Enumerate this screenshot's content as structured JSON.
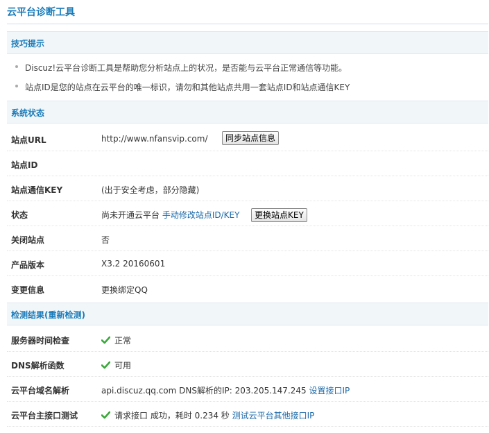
{
  "page": {
    "title": "云平台诊断工具"
  },
  "tips": {
    "header": "技巧提示",
    "items": [
      "Discuz!云平台诊断工具是帮助您分析站点上的状况，是否能与云平台正常通信等功能。",
      "站点ID是您的站点在云平台的唯一标识，请勿和其他站点共用一套站点ID和站点通信KEY"
    ]
  },
  "system": {
    "header": "系统状态",
    "site_url": {
      "label": "站点URL",
      "value": "http://www.nfansvip.com/",
      "button": "同步站点信息"
    },
    "site_id": {
      "label": "站点ID",
      "value": ""
    },
    "site_key": {
      "label": "站点通信KEY",
      "value": "(出于安全考虑，部分隐藏)"
    },
    "status": {
      "label": "状态",
      "value": "尚未开通云平台",
      "link": "手动修改站点ID/KEY",
      "button": "更换站点KEY"
    },
    "closed": {
      "label": "关闭站点",
      "value": "否"
    },
    "version": {
      "label": "产品版本",
      "value": "X3.2 20160601"
    },
    "change": {
      "label": "变更信息",
      "link": "更换绑定QQ"
    }
  },
  "detect": {
    "header": "检测结果(重新检测)",
    "time_check": {
      "label": "服务器时间检查",
      "value": "正常"
    },
    "dns_func": {
      "label": "DNS解析函数",
      "value": "可用"
    },
    "domain_resolve": {
      "label": "云平台域名解析",
      "value": "api.discuz.qq.com DNS解析的IP: 203.205.147.245",
      "link": "设置接口IP"
    },
    "api_test": {
      "label": "云平台主接口测试",
      "value": "请求接口 成功，耗时 0.234 秒",
      "link": "测试云平台其他接口IP"
    }
  },
  "colors": {
    "accent": "#1a7bb9",
    "link": "#1a68a8",
    "check": "#3aa83a",
    "section_bg": "#f1f6f9"
  }
}
